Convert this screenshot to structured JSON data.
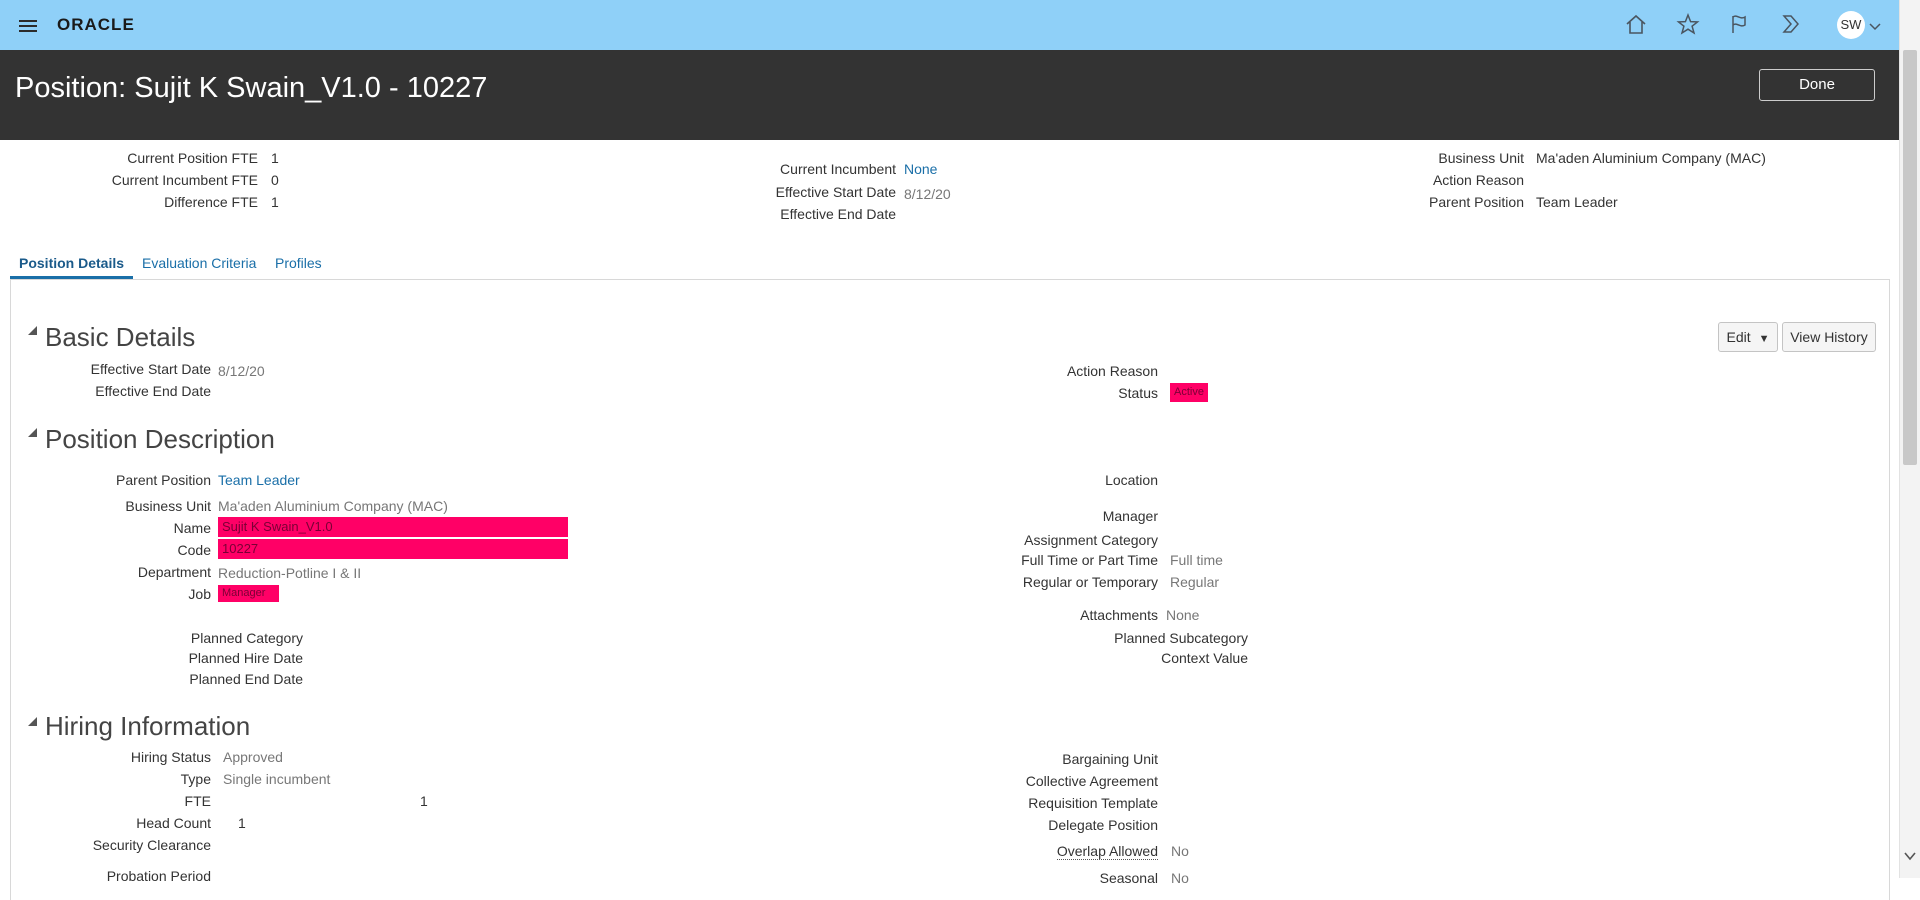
{
  "app": {
    "logo": "ORACLE",
    "user_initials": "SW"
  },
  "header": {
    "title": "Position: Sujit K Swain_V1.0 - 10227",
    "done_label": "Done"
  },
  "summary": {
    "current_position_fte_label": "Current Position FTE",
    "current_position_fte": "1",
    "current_incumbent_fte_label": "Current Incumbent FTE",
    "current_incumbent_fte": "0",
    "difference_fte_label": "Difference FTE",
    "difference_fte": "1",
    "current_incumbent_label": "Current Incumbent",
    "current_incumbent": "None",
    "effective_start_date_label": "Effective Start Date",
    "effective_start_date": "8/12/20",
    "effective_end_date_label": "Effective End Date",
    "business_unit_label": "Business Unit",
    "business_unit": "Ma'aden Aluminium Company (MAC)",
    "action_reason_label": "Action Reason",
    "parent_position_label": "Parent Position",
    "parent_position": "Team Leader"
  },
  "tabs": [
    {
      "label": "Position Details"
    },
    {
      "label": "Evaluation Criteria"
    },
    {
      "label": "Profiles"
    }
  ],
  "basic_details": {
    "title": "Basic Details",
    "edit_label": "Edit",
    "view_history_label": "View History",
    "effective_start_date_label": "Effective Start Date",
    "effective_start_date": "8/12/20",
    "effective_end_date_label": "Effective End Date",
    "action_reason_label": "Action Reason",
    "status_label": "Status",
    "status": "Active"
  },
  "position_description": {
    "title": "Position Description",
    "parent_position_label": "Parent Position",
    "parent_position": "Team Leader",
    "business_unit_label": "Business Unit",
    "business_unit": "Ma'aden Aluminium Company (MAC)",
    "name_label": "Name",
    "name": "Sujit K Swain_V1.0",
    "code_label": "Code",
    "code": "10227",
    "department_label": "Department",
    "department": "Reduction-Potline I & II",
    "job_label": "Job",
    "job": "Manager",
    "planned_category_label": "Planned Category",
    "planned_hire_date_label": "Planned Hire Date",
    "planned_end_date_label": "Planned End Date",
    "location_label": "Location",
    "manager_label": "Manager",
    "assignment_category_label": "Assignment Category",
    "full_time_label": "Full Time or Part Time",
    "full_time": "Full time",
    "regular_label": "Regular or Temporary",
    "regular": "Regular",
    "attachments_label": "Attachments",
    "attachments": "None",
    "planned_subcategory_label": "Planned Subcategory",
    "context_value_label": "Context Value"
  },
  "hiring_information": {
    "title": "Hiring Information",
    "hiring_status_label": "Hiring Status",
    "hiring_status": "Approved",
    "type_label": "Type",
    "type": "Single incumbent",
    "fte_label": "FTE",
    "fte": "1",
    "head_count_label": "Head Count",
    "head_count": "1",
    "security_clearance_label": "Security Clearance",
    "probation_period_label": "Probation Period",
    "bargaining_unit_label": "Bargaining Unit",
    "collective_agreement_label": "Collective Agreement",
    "requisition_template_label": "Requisition Template",
    "delegate_position_label": "Delegate Position",
    "overlap_allowed_label": "Overlap Allowed",
    "overlap_allowed": "No",
    "seasonal_label": "Seasonal",
    "seasonal": "No"
  }
}
